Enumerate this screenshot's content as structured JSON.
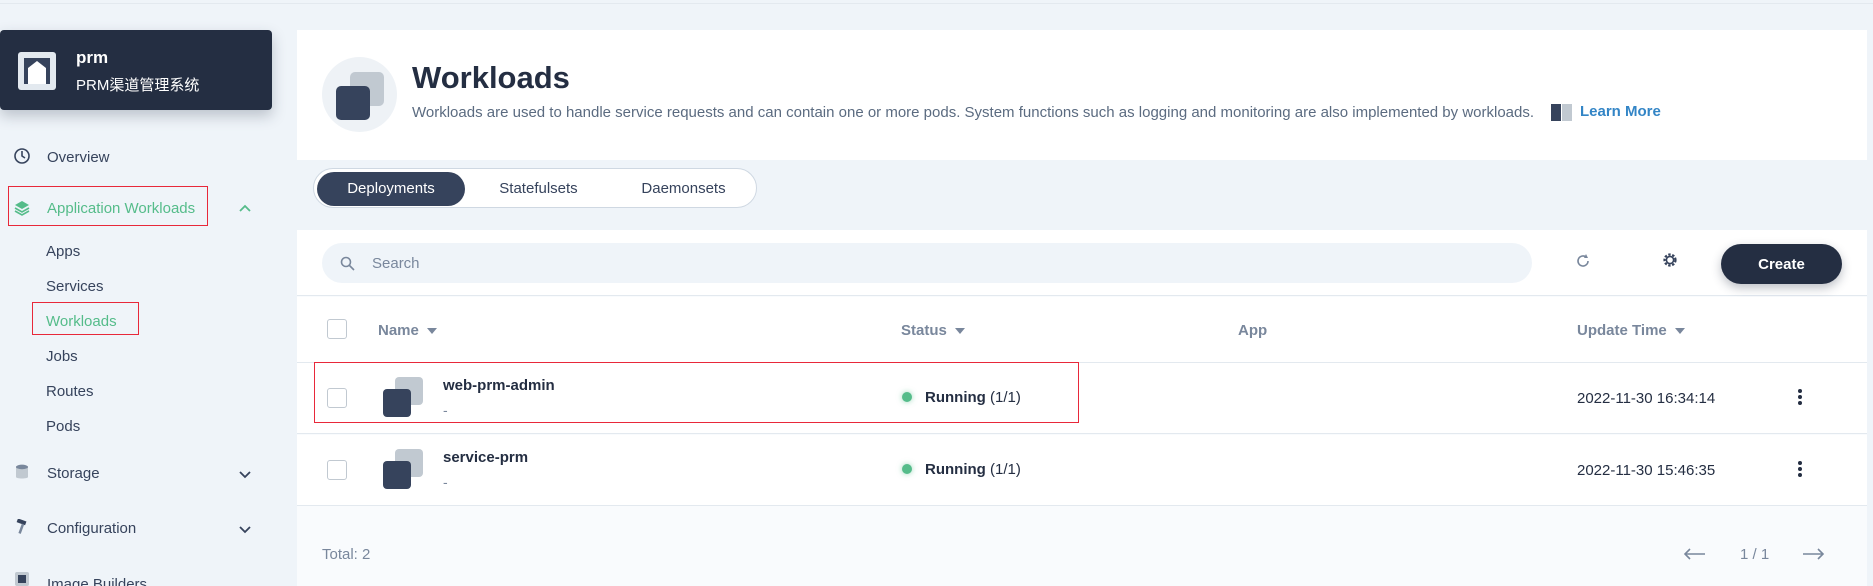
{
  "project": {
    "name": "prm",
    "description": "PRM渠道管理系统"
  },
  "sidebar": {
    "items": [
      {
        "label": "Overview",
        "icon": "dashboard-icon"
      },
      {
        "label": "Application Workloads",
        "icon": "layers-icon",
        "expanded": true
      },
      {
        "label": "Storage",
        "icon": "database-icon",
        "expanded": false
      },
      {
        "label": "Configuration",
        "icon": "hammer-icon",
        "expanded": false
      },
      {
        "label": "Image Builders",
        "icon": "image-builder-icon"
      }
    ],
    "sub_items": [
      "Apps",
      "Services",
      "Workloads",
      "Jobs",
      "Routes",
      "Pods"
    ],
    "active_sub": "Workloads"
  },
  "header": {
    "title": "Workloads",
    "description": "Workloads are used to handle service requests and can contain one or more pods. System functions such as logging and monitoring are also implemented by workloads.",
    "learn_more": "Learn More"
  },
  "tabs": [
    "Deployments",
    "Statefulsets",
    "Daemonsets"
  ],
  "active_tab": "Deployments",
  "search": {
    "placeholder": "Search"
  },
  "toolbar": {
    "create_label": "Create"
  },
  "table": {
    "columns": {
      "name": "Name",
      "status": "Status",
      "app": "App",
      "update_time": "Update Time"
    },
    "rows": [
      {
        "name": "web-prm-admin",
        "sub": "-",
        "status": "Running",
        "replicas": "(1/1)",
        "app": "",
        "update_time": "2022-11-30 16:34:14"
      },
      {
        "name": "service-prm",
        "sub": "-",
        "status": "Running",
        "replicas": "(1/1)",
        "app": "",
        "update_time": "2022-11-30 15:46:35"
      }
    ]
  },
  "footer": {
    "total": "Total: 2",
    "page": "1 / 1"
  },
  "colors": {
    "accent": "#55bc8a",
    "dark": "#242e42",
    "highlight": "#e8283a",
    "link": "#3385c6"
  }
}
